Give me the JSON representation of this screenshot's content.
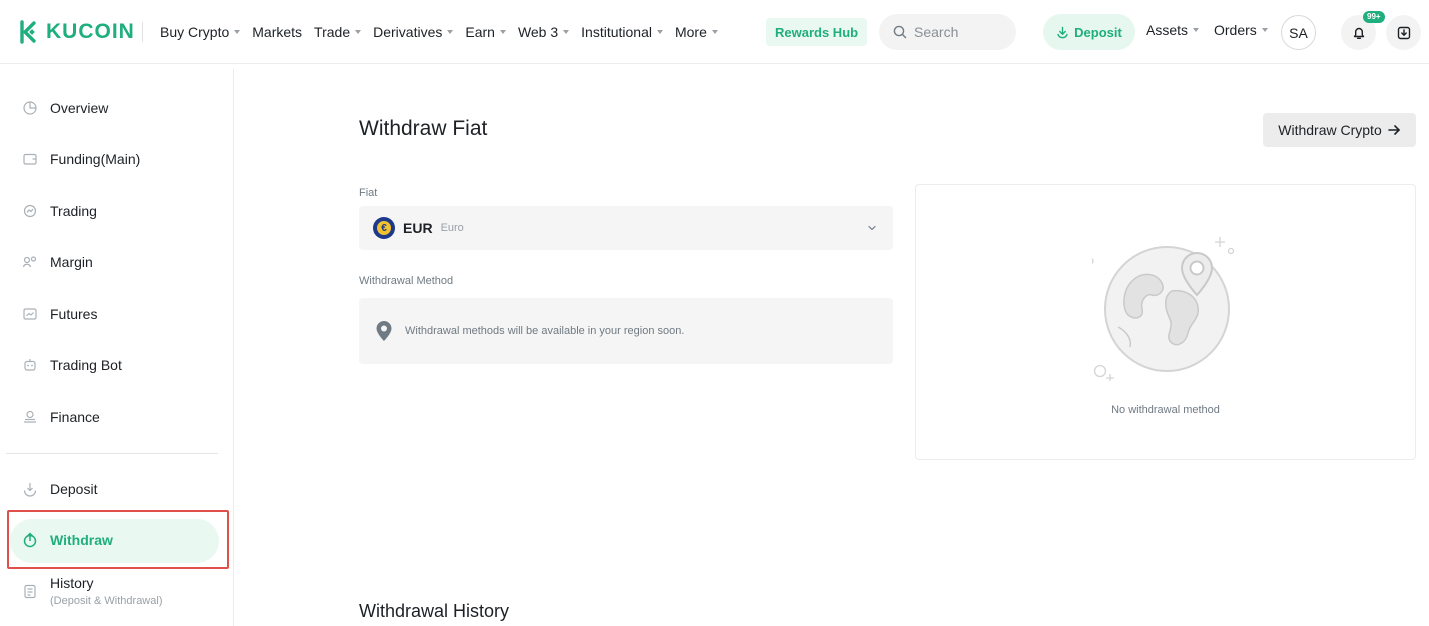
{
  "brand": {
    "name": "KUCOIN",
    "accent": "#1fae7e"
  },
  "nav": {
    "items": [
      {
        "label": "Buy Crypto",
        "dropdown": true
      },
      {
        "label": "Markets",
        "dropdown": false
      },
      {
        "label": "Trade",
        "dropdown": true
      },
      {
        "label": "Derivatives",
        "dropdown": true
      },
      {
        "label": "Earn",
        "dropdown": true
      },
      {
        "label": "Web 3",
        "dropdown": true
      },
      {
        "label": "Institutional",
        "dropdown": true
      },
      {
        "label": "More",
        "dropdown": true
      }
    ],
    "rewards": "Rewards Hub",
    "search_placeholder": "Search",
    "deposit": "Deposit",
    "assets": "Assets",
    "orders": "Orders",
    "avatar": "SA",
    "notification_badge": "99+"
  },
  "sidebar": {
    "items": [
      {
        "label": "Overview",
        "icon": "pie-chart-icon"
      },
      {
        "label": "Funding(Main)",
        "icon": "wallet-icon"
      },
      {
        "label": "Trading",
        "icon": "trading-icon"
      },
      {
        "label": "Margin",
        "icon": "margin-icon"
      },
      {
        "label": "Futures",
        "icon": "futures-icon"
      },
      {
        "label": "Trading Bot",
        "icon": "bot-icon"
      },
      {
        "label": "Finance",
        "icon": "finance-icon"
      }
    ],
    "deposit": "Deposit",
    "withdraw": "Withdraw",
    "history": "History",
    "history_sub": "(Deposit & Withdrawal)"
  },
  "main": {
    "title": "Withdraw Fiat",
    "withdraw_crypto": "Withdraw Crypto",
    "fiat_label": "Fiat",
    "fiat_code": "EUR",
    "fiat_name": "Euro",
    "method_label": "Withdrawal Method",
    "method_message": "Withdrawal methods will be available in your region soon.",
    "empty_text": "No withdrawal method",
    "history_title": "Withdrawal History"
  }
}
